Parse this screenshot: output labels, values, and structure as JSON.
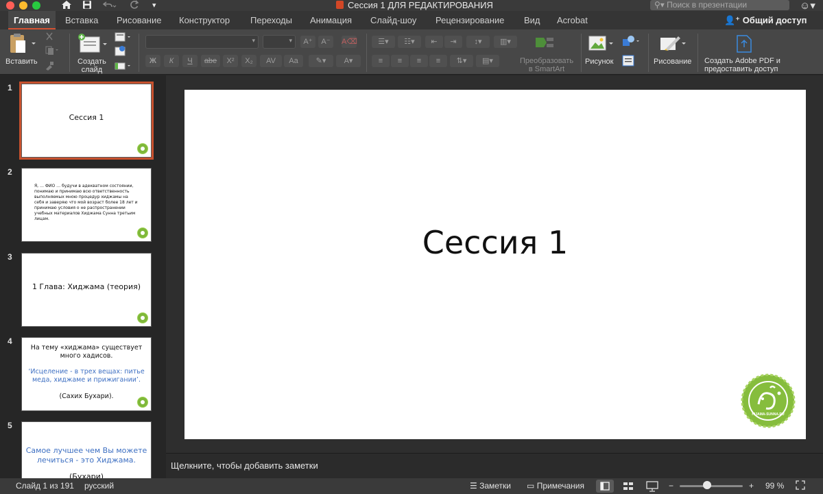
{
  "window": {
    "title": "Сессия 1 ДЛЯ РЕДАКТИРОВАНИЯ",
    "search_placeholder": "Поиск в презентации"
  },
  "quick_access": {
    "home_icon": "home-icon",
    "save_icon": "save-icon",
    "undo_icon": "undo-icon",
    "redo_icon": "redo-icon",
    "more_icon": "more-icon"
  },
  "tabs": [
    {
      "label": "Главная",
      "active": true
    },
    {
      "label": "Вставка"
    },
    {
      "label": "Рисование"
    },
    {
      "label": "Конструктор"
    },
    {
      "label": "Переходы"
    },
    {
      "label": "Анимация"
    },
    {
      "label": "Слайд-шоу"
    },
    {
      "label": "Рецензирование"
    },
    {
      "label": "Вид"
    },
    {
      "label": "Acrobat"
    }
  ],
  "share_label": "Общий доступ",
  "ribbon": {
    "paste_label": "Вставить",
    "new_slide_label_1": "Создать",
    "new_slide_label_2": "слайд",
    "format_buttons": [
      "Ж",
      "К",
      "Ч",
      "abe",
      "X²",
      "X₂",
      "AV",
      "Aa"
    ],
    "smartart_label_1": "Преобразовать",
    "smartart_label_2": "в SmartArt",
    "picture_label": "Рисунок",
    "drawing_label": "Рисование",
    "adobe_label_1": "Создать Adobe PDF и",
    "adobe_label_2": "предоставить доступ"
  },
  "slides": [
    {
      "number": "1",
      "text": "Сессия 1"
    },
    {
      "number": "2",
      "lines": [
        "Я, … ФИО … будучи в адекватном состоянии,",
        "понимаю и принимаю всю ответственность",
        "выполняемых мною процедур хиджамы на",
        "себя и заверяю что мой возраст более 18 лет и",
        "принимаю условия о не распространении",
        "учебных материалов Хиджама Сунна третьим",
        "лицам."
      ]
    },
    {
      "number": "3",
      "text": "1 Глава: Хиджама (теория)"
    },
    {
      "number": "4",
      "line1": "На тему «хиджама» существует",
      "line2": "много хадисов.",
      "quote1": "‘Исцеление - в трех вещах: питье",
      "quote2": "меда, хиджаме и прижигании’.",
      "source": "(Сахих Бухари)."
    },
    {
      "number": "5",
      "quote1": "Самое лучшее чем Вы можете",
      "quote2": "лечиться - это Хиджама.",
      "source": "(Бухари)"
    }
  ],
  "current_slide": {
    "title": "Сессия 1",
    "logo_caption": "HIJAMA-SUNNA.RU"
  },
  "notes_placeholder": "Щелкните, чтобы добавить заметки",
  "status": {
    "slide_counter": "Слайд 1 из 191",
    "language": "русский",
    "notes_label": "Заметки",
    "comments_label": "Примечания",
    "zoom_minus": "−",
    "zoom_plus": "+",
    "zoom_value": "99 %",
    "zoom_fraction": 0.43
  },
  "colors": {
    "accent": "#d65232",
    "quote_blue": "#3d6fc2",
    "logo_green": "#7fb83a"
  }
}
